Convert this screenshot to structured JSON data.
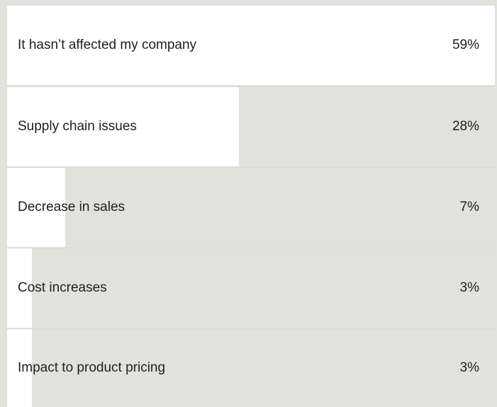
{
  "chart_data": {
    "type": "bar",
    "orientation": "horizontal",
    "categories": [
      "It hasn’t affected my company",
      "Supply chain issues",
      "Decrease in sales",
      "Cost increases",
      "Impact to product pricing"
    ],
    "values": [
      59,
      28,
      7,
      3,
      3
    ],
    "value_labels": [
      "59%",
      "28%",
      "7%",
      "3%",
      "3%"
    ],
    "unit": "%",
    "xlim": [
      0,
      59
    ],
    "colors": {
      "bar": "#ffffff",
      "background": "#e2e2dd",
      "text": "#1e1e1e"
    }
  }
}
